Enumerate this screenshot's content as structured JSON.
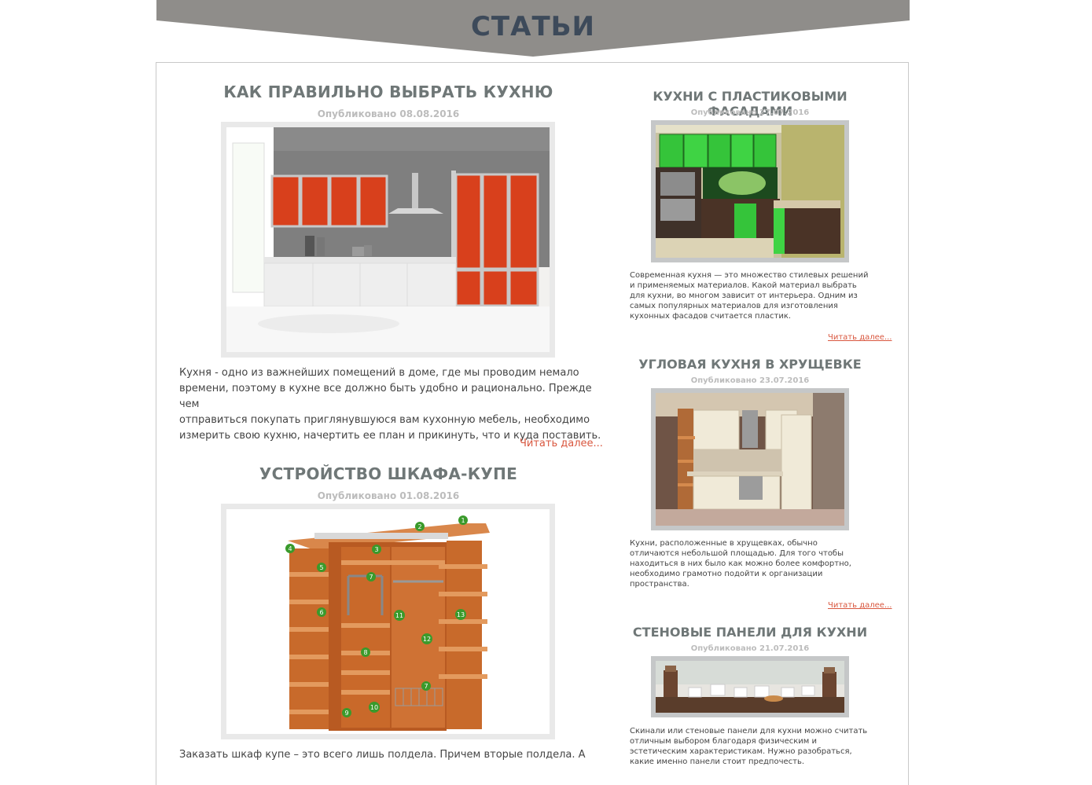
{
  "page": {
    "title": "СТАТЬИ"
  },
  "main_articles": [
    {
      "title": "КАК ПРАВИЛЬНО ВЫБРАТЬ КУХНЮ",
      "date": "Опубликовано 08.08.2016",
      "image": "kitchen-photo",
      "excerpt_lines": [
        "Кухня - одно из важнейших помещений в доме, где мы проводим немало",
        "времени, поэтому в кухне все должно быть удобно и рационально. Прежде чем",
        "отправиться покупать приглянувшуюся вам кухонную мебель, необходимо",
        "измерить свою кухню, начертить ее план и прикинуть, что и куда поставить."
      ],
      "read_more": "Читать далее..."
    },
    {
      "title": "УСТРОЙСТВО ШКАФА-КУПЕ",
      "date": "Опубликовано 01.08.2016",
      "image": "wardrobe-diagram",
      "diagram_markers": [
        "1",
        "2",
        "3",
        "4",
        "5",
        "6",
        "7",
        "7",
        "8",
        "9",
        "10",
        "11",
        "12",
        "13"
      ],
      "excerpt_lines": [
        "Заказать шкаф купе – это всего лишь полдела. Причем вторые полдела. А"
      ]
    }
  ],
  "sidebar_articles": [
    {
      "title": "КУХНИ С ПЛАСТИКОВЫМИ ФАСАДАМИ",
      "date": "Опубликовано 27.07.2016",
      "image": "green-kitchen-photo",
      "excerpt_lines": [
        "Современная кухня — это множество стилевых решений",
        "и применяемых материалов. Какой материал выбрать",
        "для кухни, во многом зависит от интерьера. Одним из",
        "самых популярных материалов для изготовления",
        "кухонных фасадов считается пластик."
      ],
      "read_more": "Читать далее..."
    },
    {
      "title": "УГЛОВАЯ КУХНЯ В ХРУЩЕВКЕ",
      "date": "Опубликовано 23.07.2016",
      "image": "corner-kitchen-photo",
      "excerpt_lines": [
        "Кухни, расположенные в хрущевках, обычно",
        "отличаются небольшой площадью. Для того чтобы",
        "находиться в них было как можно более комфортно,",
        "необходимо грамотно подойти к организации",
        "пространства."
      ],
      "read_more": "Читать далее..."
    },
    {
      "title": "СТЕНОВЫЕ ПАНЕЛИ ДЛЯ КУХНИ",
      "date": "Опубликовано 21.07.2016",
      "image": "coffee-panel-photo",
      "excerpt_lines": [
        "Скинали или стеновые панели для кухни можно считать",
        "отличным выбором благодаря физическим и",
        "эстетическим характеристикам. Нужно разобраться,",
        "какие именно панели стоит предпочесть."
      ]
    }
  ],
  "colors": {
    "banner": "#8f8d8a",
    "title": "#3d4a5a",
    "heading": "#6f7777",
    "date": "#bcbcbc",
    "link": "#d9573f"
  }
}
